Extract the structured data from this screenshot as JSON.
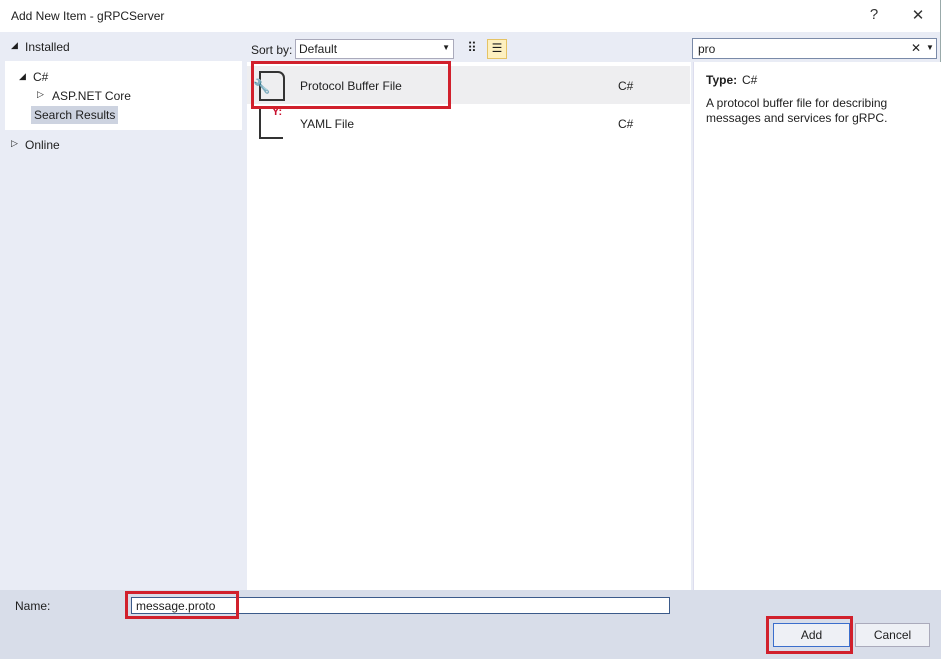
{
  "window": {
    "title": "Add New Item - gRPCServer",
    "help": "?",
    "close": "✕"
  },
  "sidebar": {
    "installed": "Installed",
    "csharp": "C#",
    "aspnet": "ASP.NET Core",
    "search_results": "Search Results",
    "online": "Online"
  },
  "toolbar": {
    "sort_label": "Sort by:",
    "sort_value": "Default"
  },
  "search": {
    "value": "pro",
    "clear": "✕"
  },
  "items": [
    {
      "name": "Protocol Buffer File",
      "lang": "C#"
    },
    {
      "name": "YAML File",
      "lang": "C#"
    }
  ],
  "details": {
    "type_label": "Type:",
    "type_value": "C#",
    "description": "A protocol buffer file for describing messages and services for gRPC."
  },
  "footer": {
    "name_label": "Name:",
    "name_value": "message.proto",
    "add": "Add",
    "cancel": "Cancel"
  },
  "colors": {
    "highlight": "#d1202c"
  }
}
